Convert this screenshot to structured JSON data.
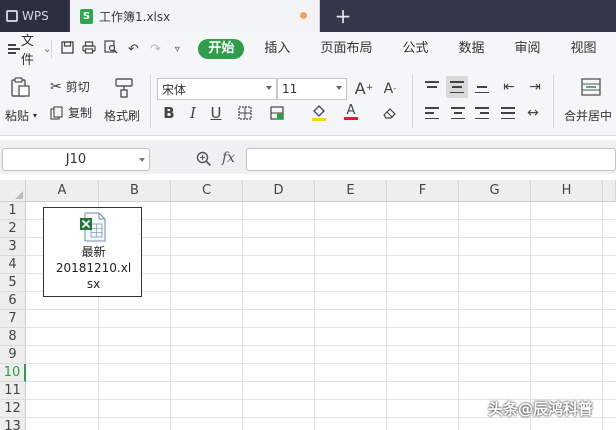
{
  "titlebar": {
    "app_tab": "WPS",
    "doc_tab": "工作簿1.xlsx",
    "doc_icon": "S",
    "new_tab": "+"
  },
  "menubar": {
    "file_label": "文件",
    "tabs": [
      "开始",
      "插入",
      "页面布局",
      "公式",
      "数据",
      "审阅",
      "视图"
    ],
    "active_tab": "开始"
  },
  "ribbon": {
    "paste": "粘贴",
    "cut": "剪切",
    "copy": "复制",
    "format_painter": "格式刷",
    "font_name": "宋体",
    "font_size": "11",
    "bold": "B",
    "italic": "I",
    "underline": "U",
    "font_color_letter": "A",
    "merge_center": "合并居中",
    "accent_color": "#2e9e4a"
  },
  "formula_bar": {
    "name_box": "J10",
    "fx": "fx",
    "formula": ""
  },
  "grid": {
    "columns": [
      "A",
      "B",
      "C",
      "D",
      "E",
      "F",
      "G",
      "H"
    ],
    "rows": [
      "1",
      "2",
      "3",
      "4",
      "5",
      "6",
      "7",
      "8",
      "9",
      "10",
      "11",
      "12",
      "13"
    ],
    "active_row": "10"
  },
  "embedded_object": {
    "label_line1": "最新20181210.xl",
    "label_line2": "sx",
    "icon": "excel-file-icon"
  },
  "watermark": "头条@辰鸿科普"
}
